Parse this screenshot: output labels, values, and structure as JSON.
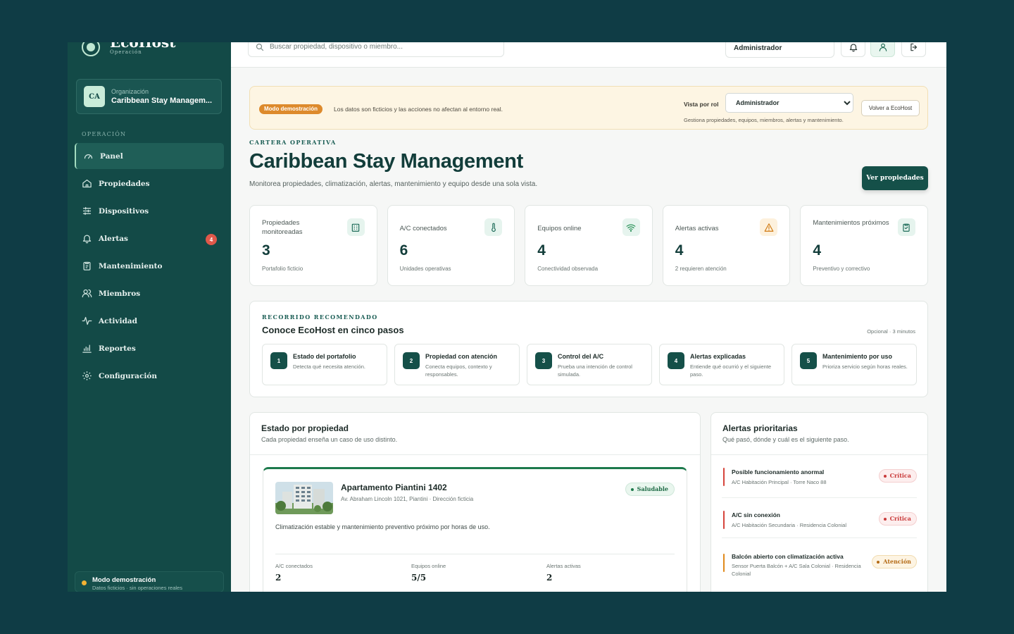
{
  "brand": {
    "name": "EcoHost",
    "subtitle": "Operación"
  },
  "org": {
    "initials": "CA",
    "label": "Organización",
    "name": "Caribbean Stay Managem..."
  },
  "sidebar": {
    "section_label": "OPERACIÓN",
    "items": [
      {
        "label": "Panel",
        "icon": "gauge-icon",
        "active": true
      },
      {
        "label": "Propiedades",
        "icon": "home-icon"
      },
      {
        "label": "Dispositivos",
        "icon": "sliders-icon"
      },
      {
        "label": "Alertas",
        "icon": "bell-icon",
        "badge": "4"
      },
      {
        "label": "Mantenimiento",
        "icon": "clipboard-icon"
      },
      {
        "label": "Miembros",
        "icon": "users-icon"
      },
      {
        "label": "Actividad",
        "icon": "activity-icon"
      },
      {
        "label": "Reportes",
        "icon": "chart-icon"
      },
      {
        "label": "Configuración",
        "icon": "gear-icon"
      }
    ],
    "demo": {
      "title": "Modo demostración",
      "subtitle": "Datos ficticios · sin operaciones reales",
      "dot_color": "#f2b233"
    }
  },
  "topbar": {
    "search_placeholder": "Buscar propiedad, dispositivo o miembro...",
    "role": "Administrador"
  },
  "banner": {
    "pill": "Modo demostración",
    "text": "Los datos son ficticios y las acciones no afectan al entorno real.",
    "role_label": "Vista por rol",
    "role_value": "Administrador",
    "role_hint": "Gestiona propiedades, equipos, miembros, alertas y mantenimiento.",
    "back_label": "Volver a EcoHost"
  },
  "header": {
    "eyebrow": "CARTERA OPERATIVA",
    "title": "Caribbean Stay Management",
    "subtitle": "Monitorea propiedades, climatización, alertas, mantenimiento y equipo desde una sola vista.",
    "cta": "Ver propiedades"
  },
  "kpis": [
    {
      "label": "Propiedades monitoreadas",
      "value": "3",
      "sub": "Portafolio ficticio",
      "icon": "building-icon",
      "color": "#1b6a57",
      "bg": "#e6f4ee"
    },
    {
      "label": "A/C conectados",
      "value": "6",
      "sub": "Unidades operativas",
      "icon": "thermometer-icon",
      "color": "#1b6a57",
      "bg": "#e6f4ee"
    },
    {
      "label": "Equipos online",
      "value": "4",
      "sub": "Conectividad observada",
      "icon": "wifi-icon",
      "color": "#1b8a4c",
      "bg": "#e6f4ee"
    },
    {
      "label": "Alertas activas",
      "value": "4",
      "sub": "2 requieren atención",
      "icon": "warning-icon",
      "color": "#d07a12",
      "bg": "#fdf1dd"
    },
    {
      "label": "Mantenimientos próximos",
      "value": "4",
      "sub": "Preventivo y correctivo",
      "icon": "clipboard-check-icon",
      "color": "#1b6a57",
      "bg": "#e6f4ee"
    }
  ],
  "tour": {
    "eyebrow": "RECORRIDO RECOMENDADO",
    "title": "Conoce EcoHost en cinco pasos",
    "meta": "Opcional · 3 minutos",
    "steps": [
      {
        "n": "1",
        "title": "Estado del portafolio",
        "desc": "Detecta qué necesita atención."
      },
      {
        "n": "2",
        "title": "Propiedad con atención",
        "desc": "Conecta equipos, contexto y responsables."
      },
      {
        "n": "3",
        "title": "Control del A/C",
        "desc": "Prueba una intención de control simulada."
      },
      {
        "n": "4",
        "title": "Alertas explicadas",
        "desc": "Entiende qué ocurrió y el siguiente paso."
      },
      {
        "n": "5",
        "title": "Mantenimiento por uso",
        "desc": "Prioriza servicio según horas reales."
      }
    ]
  },
  "properties_panel": {
    "title": "Estado por propiedad",
    "subtitle": "Cada propiedad enseña un caso de uso distinto.",
    "property": {
      "name": "Apartamento Piantini 1402",
      "address": "Av. Abraham Lincoln 1021, Piantini · Dirección ficticia",
      "status": "Saludable",
      "description": "Climatización estable y mantenimiento preventivo próximo por horas de uso.",
      "stats": [
        {
          "label": "A/C conectados",
          "value": "2"
        },
        {
          "label": "Equipos online",
          "value": "5/5"
        },
        {
          "label": "Alertas activas",
          "value": "2"
        }
      ]
    }
  },
  "alerts_panel": {
    "title": "Alertas prioritarias",
    "subtitle": "Qué pasó, dónde y cuál es el siguiente paso.",
    "items": [
      {
        "title": "Posible funcionamiento anormal",
        "location": "A/C Habitación Principal · Torre Naco 88",
        "severity": "Crítica",
        "level": "crit"
      },
      {
        "title": "A/C sin conexión",
        "location": "A/C Habitación Secundaria · Residencia Colonial",
        "severity": "Crítica",
        "level": "crit"
      },
      {
        "title": "Balcón abierto con climatización activa",
        "location": "Sensor Puerta Balcón + A/C Sala Colonial · Residencia Colonial",
        "severity": "Atención",
        "level": "warn"
      }
    ]
  },
  "colors": {
    "sidebar_bg": "#134a47",
    "page_bg": "#0f3c45",
    "accent": "#155049",
    "critical": "#c93a3a",
    "warning": "#d07a12",
    "healthy": "#1d7a4c"
  }
}
